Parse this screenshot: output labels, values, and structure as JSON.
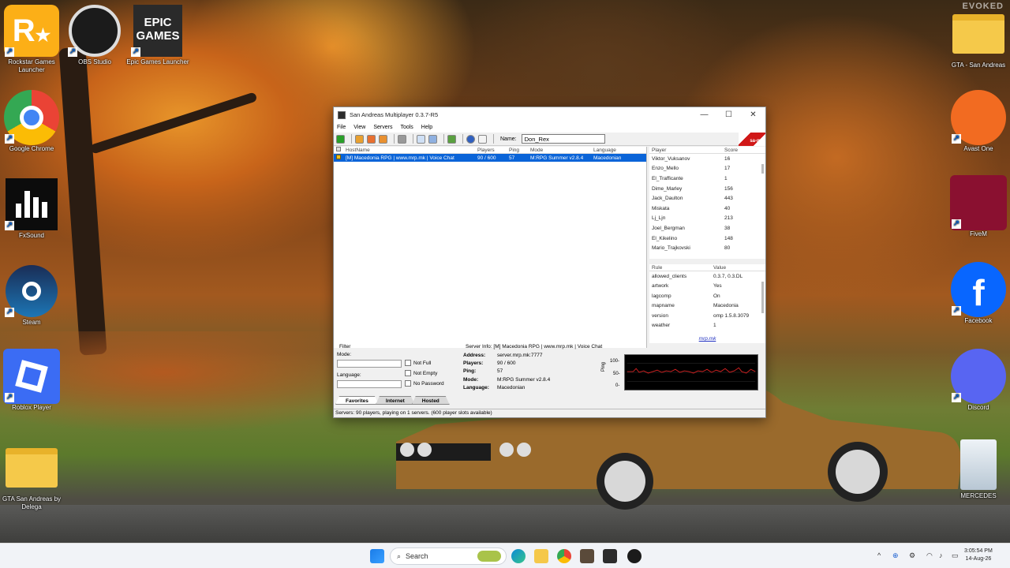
{
  "wallpaper": {
    "watermark": "EVOKED"
  },
  "desktop_icons": [
    {
      "id": "rockstar",
      "label": "Rockstar Games Launcher",
      "icon": "rockstar-icon"
    },
    {
      "id": "obs",
      "label": "OBS Studio",
      "icon": "obs-icon"
    },
    {
      "id": "epic",
      "label": "Epic Games Launcher",
      "icon": "epic-games-icon",
      "logo_text": "EPIC GAMES"
    },
    {
      "id": "chrome",
      "label": "Google Chrome",
      "icon": "chrome-icon"
    },
    {
      "id": "fxsound",
      "label": "FxSound",
      "icon": "fxsound-icon"
    },
    {
      "id": "steam",
      "label": "Steam",
      "icon": "steam-icon"
    },
    {
      "id": "roblox",
      "label": "Roblox Player",
      "icon": "roblox-icon"
    },
    {
      "id": "gta_folder",
      "label": "GTA San Andreas by Delega",
      "icon": "folder-icon"
    },
    {
      "id": "gta_sa",
      "label": "GTA - San Andreas",
      "icon": "folder-icon"
    },
    {
      "id": "avast",
      "label": "Avast One",
      "icon": "avast-icon"
    },
    {
      "id": "fivem",
      "label": "FiveM",
      "icon": "fivem-icon"
    },
    {
      "id": "facebook",
      "label": "Facebook",
      "icon": "facebook-icon"
    },
    {
      "id": "discord",
      "label": "Discord",
      "icon": "discord-icon"
    },
    {
      "id": "recycle",
      "label": "MERCEDES",
      "icon": "recycle-bin-icon"
    }
  ],
  "window": {
    "title": "San Andreas Multiplayer 0.3.7-R5",
    "menu": [
      "File",
      "View",
      "Servers",
      "Tools",
      "Help"
    ],
    "name_label": "Name:",
    "name_value": "Don_Rex",
    "logo_text": "sa-mp",
    "server_columns": [
      "HostName",
      "Players",
      "Ping",
      "Mode",
      "Language"
    ],
    "servers": [
      {
        "hostname": "[M] Macedonia RPG | www.mrp.mk | Voice Chat",
        "players": "90 / 600",
        "ping": "57",
        "mode": "M:RPG Summer v2.8.4",
        "language": "Macedonian"
      }
    ],
    "player_columns": [
      "Player",
      "Score"
    ],
    "players": [
      {
        "name": "Viktor_Vuksanov",
        "score": "16"
      },
      {
        "name": "Enzo_Mello",
        "score": "17"
      },
      {
        "name": "El_Trafficante",
        "score": "1"
      },
      {
        "name": "Dime_Marley",
        "score": "156"
      },
      {
        "name": "Jack_Daulton",
        "score": "443"
      },
      {
        "name": "Miskata",
        "score": "40"
      },
      {
        "name": "Lj_Ljn",
        "score": "213"
      },
      {
        "name": "Joel_Bergman",
        "score": "38"
      },
      {
        "name": "El_Kikelino",
        "score": "148"
      },
      {
        "name": "Mario_Trajkovski",
        "score": "80"
      }
    ],
    "rule_columns": [
      "Rule",
      "Value"
    ],
    "rules": [
      {
        "rule": "allowed_clients",
        "value": "0.3.7, 0.3.DL"
      },
      {
        "rule": "artwork",
        "value": "Yes"
      },
      {
        "rule": "lagcomp",
        "value": "On"
      },
      {
        "rule": "mapname",
        "value": "Macedonia"
      },
      {
        "rule": "version",
        "value": "omp 1.5.8.3079"
      },
      {
        "rule": "weather",
        "value": "1"
      }
    ],
    "rules_link": "mrp.mk",
    "filter": {
      "title": "Filter",
      "mode_label": "Mode:",
      "language_label": "Language:",
      "not_full": "Not Full",
      "not_empty": "Not Empty",
      "no_password": "No Password"
    },
    "server_info": {
      "title": "Server Info: [M] Macedonia RPG | www.mrp.mk | Voice Chat",
      "address_label": "Address:",
      "address": "server.mrp.mk:7777",
      "players_label": "Players:",
      "players": "90 / 600",
      "ping_label": "Ping:",
      "ping": "57",
      "mode_label": "Mode:",
      "mode": "M:RPG Summer v2.8.4",
      "language_label": "Language:",
      "language": "Macedonian",
      "graph_axis": "Ping",
      "graph_ticks": [
        "100-",
        "50-",
        "0-"
      ]
    },
    "tabs": [
      "Favorites",
      "Internet",
      "Hosted"
    ],
    "active_tab": "Favorites",
    "status": "Servers: 90 players, playing on 1 servers. (600 player slots available)"
  },
  "taskbar": {
    "search_placeholder": "Search",
    "time": "3:05:54 PM",
    "date": "14-Aug-26"
  }
}
